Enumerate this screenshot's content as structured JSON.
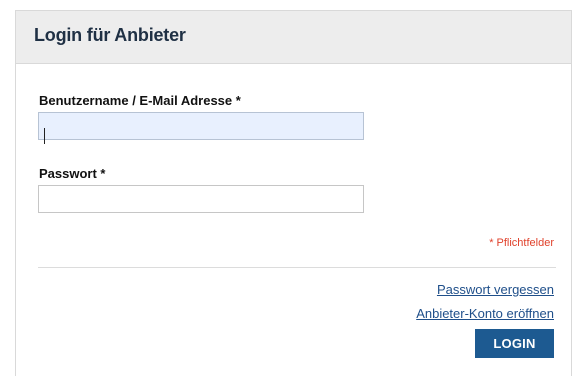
{
  "panel": {
    "title": "Login für Anbieter"
  },
  "form": {
    "username_label": "Benutzername / E-Mail Adresse *",
    "username_value": "",
    "password_label": "Passwort *",
    "password_value": "",
    "required_note": "* Pflichtfelder"
  },
  "links": {
    "forgot_password": "Passwort vergessen",
    "open_account": "Anbieter-Konto eröffnen"
  },
  "actions": {
    "login_label": "LOGIN"
  },
  "colors": {
    "accent": "#1d5a91",
    "required": "#e0412b",
    "link": "#1f4f8a"
  }
}
